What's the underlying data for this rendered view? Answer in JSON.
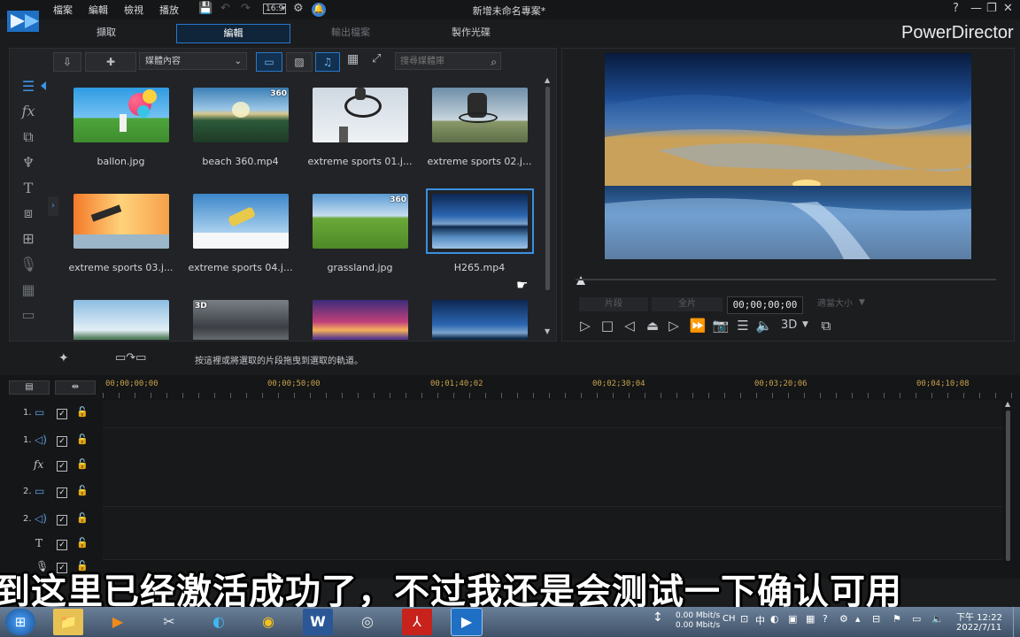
{
  "app": {
    "brand": "PowerDirector",
    "document_title": "新增未命名專案*",
    "menu": [
      "檔案",
      "編輯",
      "檢視",
      "播放"
    ],
    "aspect_ratio": "16:9",
    "window_controls": [
      "?",
      "—",
      "❐",
      "✕"
    ]
  },
  "mode_tabs": [
    {
      "label": "擷取",
      "state": "normal"
    },
    {
      "label": "編輯",
      "state": "active"
    },
    {
      "label": "輸出檔案",
      "state": "disabled"
    },
    {
      "label": "製作光碟",
      "state": "normal"
    }
  ],
  "library": {
    "dropdown": "媒體內容",
    "search_placeholder": "搜尋媒體庫",
    "items": [
      {
        "name": "ballon.jpg",
        "badge": ""
      },
      {
        "name": "beach 360.mp4",
        "badge": "360"
      },
      {
        "name": "extreme sports 01.j...",
        "badge": ""
      },
      {
        "name": "extreme sports 02.j...",
        "badge": ""
      },
      {
        "name": "extreme sports 03.j...",
        "badge": ""
      },
      {
        "name": "extreme sports 04.j...",
        "badge": ""
      },
      {
        "name": "grassland.jpg",
        "badge": "360"
      },
      {
        "name": "H265.mp4",
        "badge": "",
        "selected": true
      },
      {
        "name": "",
        "badge": ""
      },
      {
        "name": "",
        "badge": "3D"
      },
      {
        "name": "",
        "badge": ""
      },
      {
        "name": "",
        "badge": ""
      }
    ]
  },
  "preview": {
    "clip_label": "片段",
    "movie_label": "全片",
    "timecode": "00;00;00;00",
    "fit_label": "適當大小",
    "mode_3d": "3D"
  },
  "timeline": {
    "hint": "按這裡或將選取的片段拖曳到選取的軌道。",
    "ruler": [
      "00;00;00;00",
      "00;00;50;00",
      "00;01;40;02",
      "00;02;30;04",
      "00;03;20;06",
      "00;04;10;08"
    ],
    "tracks": [
      {
        "num": "1.",
        "icon": "video-track-icon"
      },
      {
        "num": "1.",
        "icon": "audio-track-icon"
      },
      {
        "num": "",
        "icon": "fx-track-icon"
      },
      {
        "num": "2.",
        "icon": "video-track-icon"
      },
      {
        "num": "2.",
        "icon": "audio-track-icon"
      },
      {
        "num": "",
        "icon": "title-track-icon"
      },
      {
        "num": "",
        "icon": "voice-track-icon"
      }
    ]
  },
  "subtitle": "到这里已经激活成功了，不过我还是会测试一下确认可用",
  "taskbar": {
    "net_up": "0.00 Mbit/s",
    "net_down": "0.00 Mbit/s",
    "ime": "CH",
    "ime_mode": "中",
    "time": "下午 12:22",
    "date": "2022/7/11"
  },
  "colors": {
    "accent": "#2a78c8",
    "ruler_text": "#c8a14a",
    "background": "#1b1c1e"
  }
}
